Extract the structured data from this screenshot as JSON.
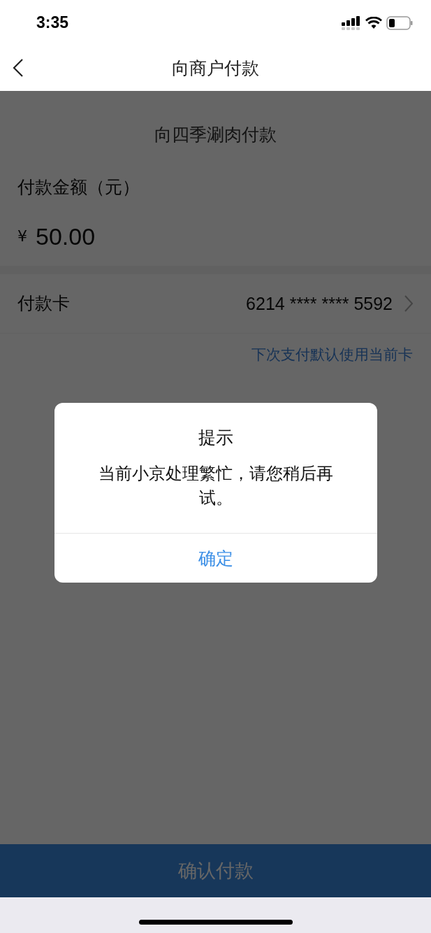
{
  "status_bar": {
    "time": "3:35"
  },
  "nav": {
    "title": "向商户付款"
  },
  "payment": {
    "merchant": "向四季涮肉付款",
    "amount_label": "付款金额（元）",
    "currency": "¥",
    "amount": "50.00",
    "card_label": "付款卡",
    "card_number": "6214 **** **** 5592",
    "default_card_link": "下次支付默认使用当前卡"
  },
  "confirm_button": {
    "label": "确认付款"
  },
  "dialog": {
    "title": "提示",
    "message": "当前小京处理繁忙，请您稍后再试。",
    "buttons": [
      "确定"
    ]
  }
}
